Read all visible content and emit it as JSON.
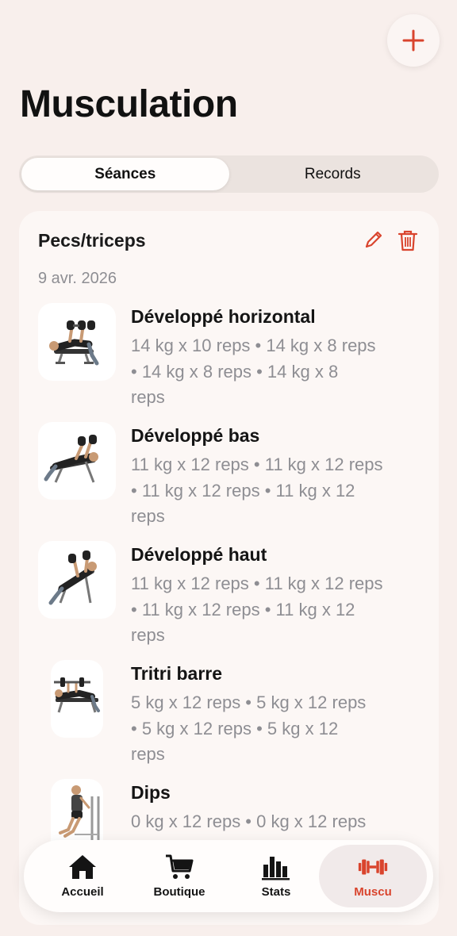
{
  "header": {
    "title": "Musculation",
    "add_icon": "plus-icon"
  },
  "segments": [
    {
      "label": "Séances",
      "active": true
    },
    {
      "label": "Records",
      "active": false
    }
  ],
  "session": {
    "title": "Pecs/triceps",
    "date": "9 avr. 2026",
    "edit_icon": "pencil-icon",
    "delete_icon": "trash-icon",
    "exercises": [
      {
        "name": "Développé horizontal",
        "sets": "14 kg x 10 reps  •  14 kg x 8 reps\n•  14 kg x 8 reps  •  14 kg x 8\nreps"
      },
      {
        "name": "Développé bas",
        "sets": "11 kg x 12 reps  •  11 kg x 12 reps\n•  11 kg x 12 reps  •  11 kg x 12\nreps"
      },
      {
        "name": "Développé haut",
        "sets": "11 kg x 12 reps  •  11 kg x 12 reps\n•  11 kg x 12 reps  •  11 kg x 12\nreps"
      },
      {
        "name": "Tritri barre",
        "sets": "5 kg x 12 reps  •  5 kg x 12 reps\n•  5 kg x 12 reps  •  5 kg x 12\nreps"
      },
      {
        "name": "Dips",
        "sets": "0 kg x 12 reps  •  0 kg x 12 reps"
      }
    ]
  },
  "tabbar": {
    "items": [
      {
        "label": "Accueil",
        "icon": "home-icon",
        "active": false
      },
      {
        "label": "Boutique",
        "icon": "cart-icon",
        "active": false
      },
      {
        "label": "Stats",
        "icon": "bar-chart-icon",
        "active": false
      },
      {
        "label": "Muscu",
        "icon": "dumbbell-icon",
        "active": true
      }
    ]
  },
  "colors": {
    "accent": "#d9442d",
    "background": "#f8efec",
    "card": "#fcf7f5",
    "muted_text": "#8e8e93"
  }
}
